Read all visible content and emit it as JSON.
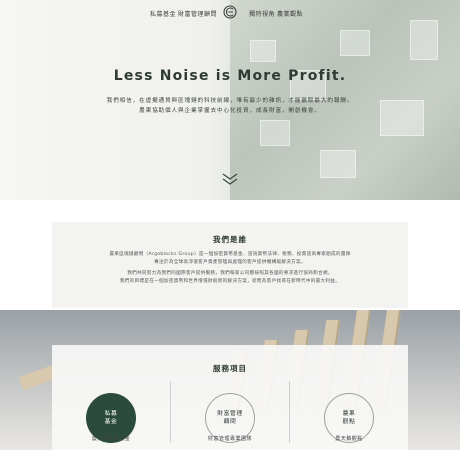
{
  "nav": {
    "left_items": [
      "私募基金",
      "財富管理顧問"
    ],
    "right_items": [
      "獨特視角",
      "農業觀點"
    ]
  },
  "hero": {
    "title": "Less Noise is More Profit.",
    "subtitle_lines": [
      "我們相信，在虛擬通貨與區塊鏈的科技前線，唯有最少的雜訊，才能贏取最大的報酬。",
      "農果協助個人與企業掌握去中心化投資，成長財富，開創機會。"
    ]
  },
  "about": {
    "title": "我們是誰",
    "para1_lines": [
      "農果區塊鏈顧問（Argoblocks Group）是一個加密貨幣基金、諮詢貨幣法律、稅務、投資諮商專家組成的團隊",
      "專注於為全球高淨值客戶資產管理與處理的客戶提供機構級解決方案。"
    ],
    "para2_lines": [
      "我們共同努力為我們的國際客戶提供服務，我們每家公司都按照其各國的要求進行協商和合規。",
      "我們的目標是在一個加密貨幣和世界增值財創新的解決方案，從而為客戶找尋在新時代中的最大利益。"
    ]
  },
  "services": {
    "title": "服務項目",
    "items": [
      {
        "circle_label": "私募\n基金",
        "caption": "農天鵝私募基金",
        "style": "dark"
      },
      {
        "circle_label": "財富管理\n顧問",
        "caption": "財富管理專業團隊",
        "style": "light"
      },
      {
        "circle_label": "農果\n觀點",
        "caption": "農天鵝觀點",
        "style": "light"
      }
    ]
  },
  "colors": {
    "accent_dark_green": "#2b4b3d",
    "title_text": "#2f3a34"
  }
}
